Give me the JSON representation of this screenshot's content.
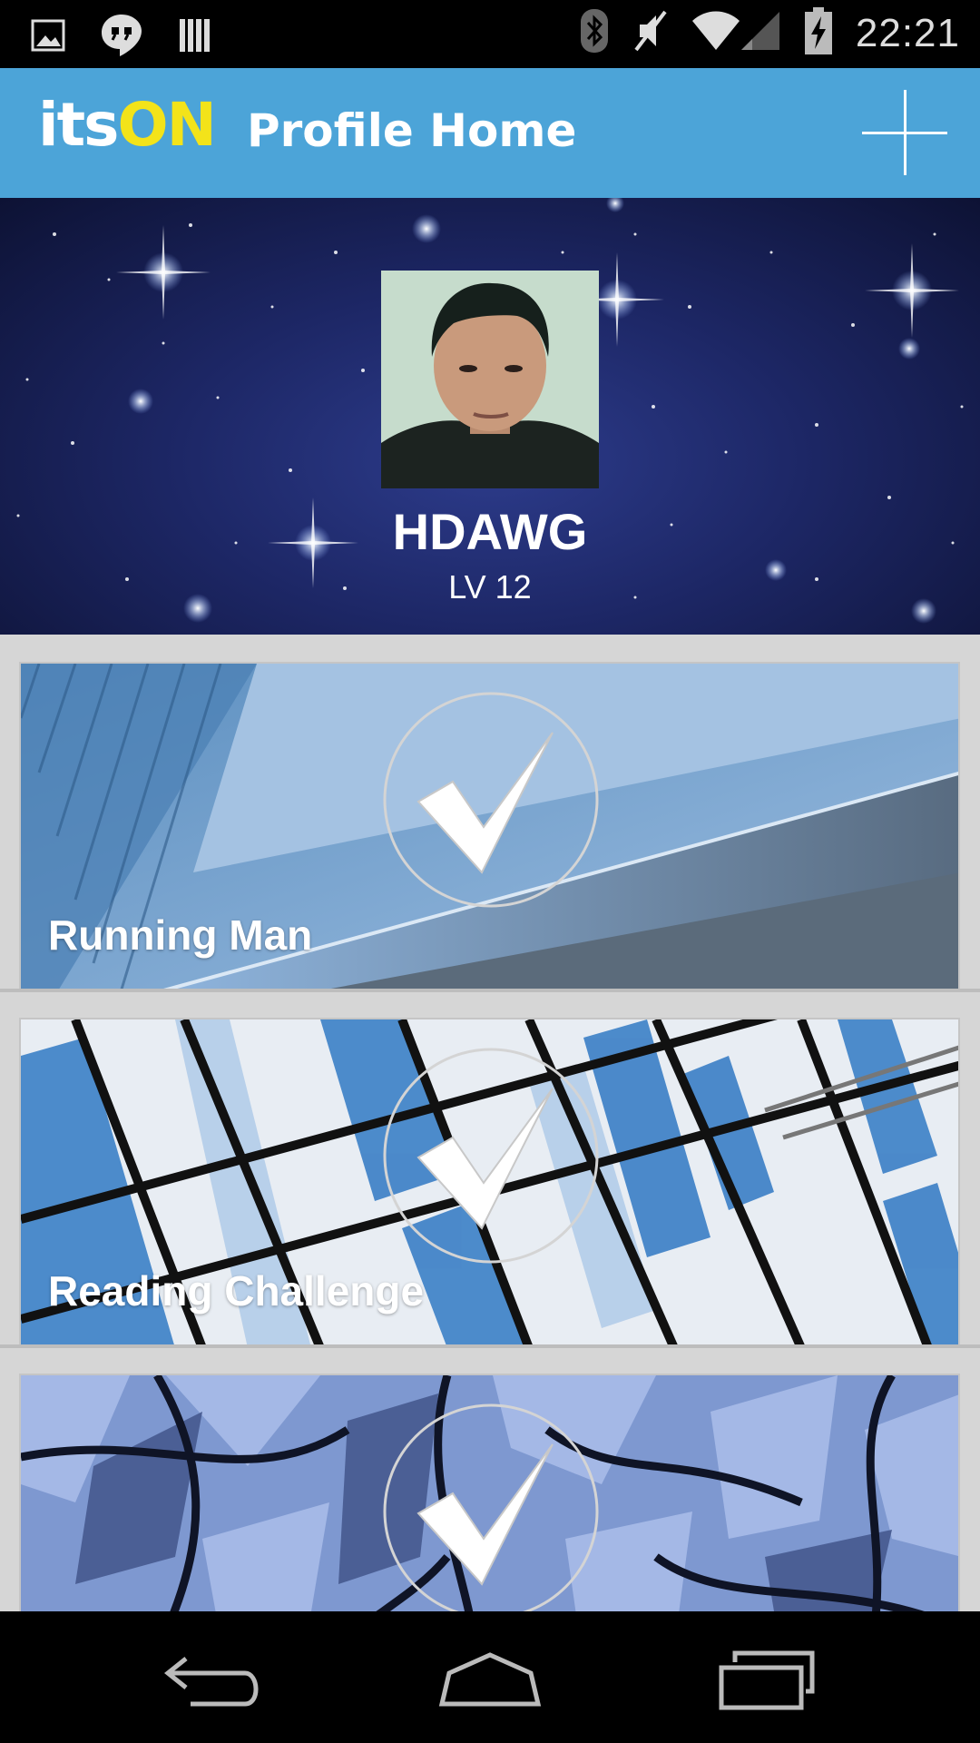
{
  "status_bar": {
    "time": "22:21",
    "left_icons": [
      "image-icon",
      "hangouts-icon",
      "library-icon"
    ],
    "right_icons": [
      "bluetooth-icon",
      "mute-icon",
      "wifi-icon",
      "signal-icon",
      "battery-charging-icon"
    ]
  },
  "app_bar": {
    "logo_its": "its",
    "logo_on": "ON",
    "title": "Profile Home",
    "add_icon": "plus-icon",
    "colors": {
      "bar": "#4ca4d8",
      "logo_accent": "#f3e31a"
    }
  },
  "profile": {
    "name": "HDAWG",
    "level": "LV 12",
    "background": "starfield"
  },
  "challenges": [
    {
      "title": "Running Man",
      "completed": true
    },
    {
      "title": "Reading Challenge",
      "completed": true
    },
    {
      "title": "",
      "completed": true
    }
  ],
  "nav_bar": {
    "buttons": [
      "back-icon",
      "home-icon",
      "recent-apps-icon"
    ]
  }
}
